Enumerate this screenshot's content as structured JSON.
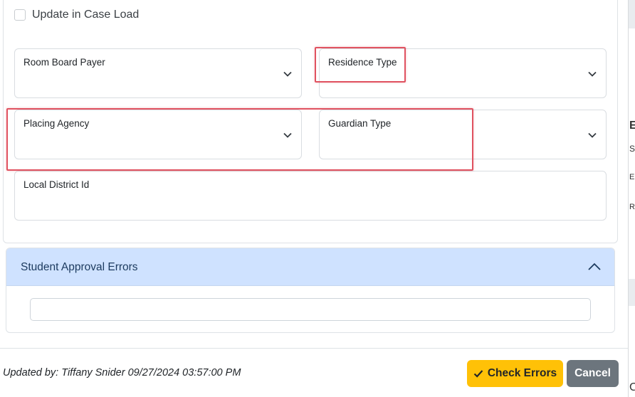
{
  "checkbox": {
    "label": "Update in Case Load",
    "checked": false
  },
  "fields": {
    "room_board_payer": "Room Board Payer",
    "residence_type": "Residence Type",
    "placing_agency": "Placing Agency",
    "guardian_type": "Guardian Type",
    "local_district_id": "Local District Id"
  },
  "accordion": {
    "title": "Student Approval Errors",
    "expanded": true
  },
  "footer": {
    "updated_by": "Updated by: Tiffany Snider 09/27/2024 03:57:00 PM",
    "check_errors_label": "Check Errors",
    "cancel_label": "Cancel"
  },
  "background_fragments": [
    "E",
    "S",
    "E",
    "R",
    "C"
  ],
  "colors": {
    "accordion_header": "#cfe2ff",
    "warning_button": "#ffc107",
    "secondary_button": "#6c757d",
    "highlight": "#e05260"
  }
}
